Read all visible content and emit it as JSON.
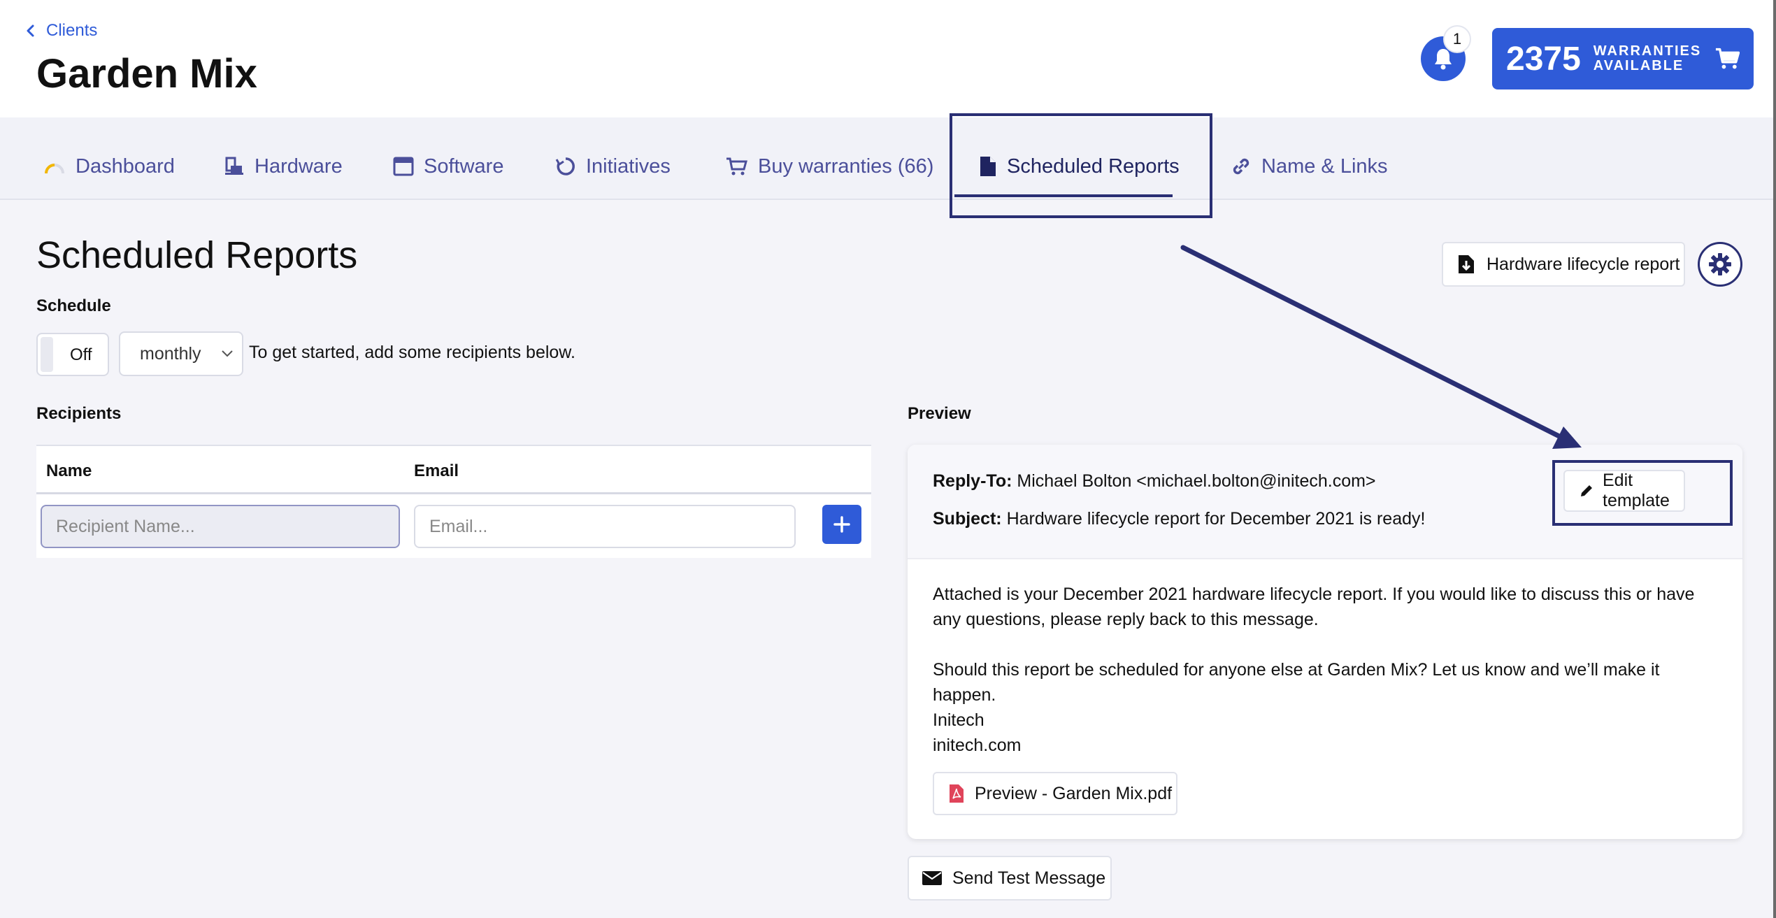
{
  "header": {
    "back_label": "Clients",
    "client_name": "Garden Mix",
    "notification_count": "1",
    "warranty_count": "2375",
    "warranty_label_line1": "WARRANTIES",
    "warranty_label_line2": "AVAILABLE"
  },
  "tabs": [
    {
      "label": "Dashboard",
      "icon": "gauge-icon"
    },
    {
      "label": "Hardware",
      "icon": "hardware-icon"
    },
    {
      "label": "Software",
      "icon": "window-icon"
    },
    {
      "label": "Initiatives",
      "icon": "cycle-icon"
    },
    {
      "label": "Buy warranties (66)",
      "icon": "cart-icon"
    },
    {
      "label": "Scheduled Reports",
      "icon": "document-icon",
      "active": true
    },
    {
      "label": "Name & Links",
      "icon": "link-icon"
    }
  ],
  "page": {
    "title": "Scheduled Reports",
    "hardware_report_button": "Hardware lifecycle report"
  },
  "schedule": {
    "label": "Schedule",
    "toggle_state": "Off",
    "frequency": "monthly",
    "hint": "To get started, add some recipients below."
  },
  "recipients": {
    "label": "Recipients",
    "col_name": "Name",
    "col_email": "Email",
    "name_placeholder": "Recipient Name...",
    "email_placeholder": "Email..."
  },
  "preview": {
    "label": "Preview",
    "reply_to_label": "Reply-To:",
    "reply_to_value": "Michael Bolton <michael.bolton@initech.com>",
    "subject_label": "Subject:",
    "subject_value": "Hardware lifecycle report for December 2021 is ready!",
    "edit_template": "Edit template",
    "para1": "Attached is your December 2021 hardware lifecycle report. If you would like to discuss this or have any questions, please reply back to this message.",
    "para2": "Should this report be scheduled for anyone else at Garden Mix? Let us know and we’ll make it happen.",
    "sig_company": "Initech",
    "sig_site": "initech.com",
    "attachment": "Preview - Garden Mix.pdf"
  },
  "actions": {
    "send_test": "Send Test Message"
  },
  "colors": {
    "accent": "#2f5bd8",
    "tab_text": "#4b4f9a",
    "annotation": "#2a2f74",
    "pdf_red": "#e0445a",
    "gauge_yellow": "#f2b705"
  }
}
